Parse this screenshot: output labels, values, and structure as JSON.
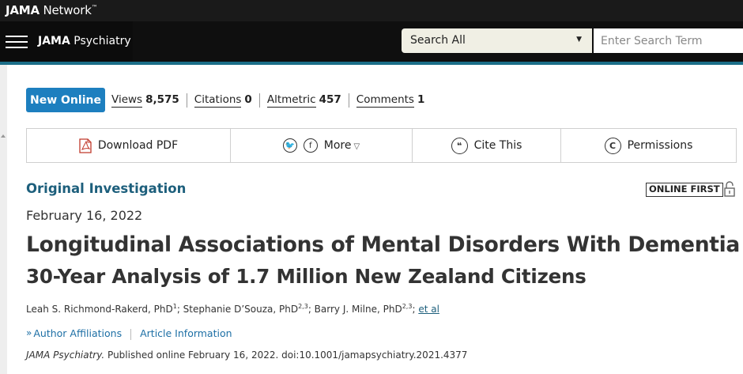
{
  "network": {
    "logo_bold": "JAMA",
    "logo_rest": " Network",
    "logo_mark": "™"
  },
  "journal": {
    "name_bold": "JAMA",
    "name_rest": " Psychiatry"
  },
  "search": {
    "scope_label": "Search All",
    "placeholder": "Enter Search Term"
  },
  "metrics": {
    "new_online_label": "New Online",
    "items": [
      {
        "label": "Views",
        "value": "8,575"
      },
      {
        "label": "Citations",
        "value": "0"
      },
      {
        "label": "Altmetric",
        "value": "457"
      },
      {
        "label": "Comments",
        "value": "1"
      }
    ]
  },
  "toolbar": {
    "pdf_label": "Download PDF",
    "twitter_icon_glyph": "🐦",
    "facebook_icon_glyph": "f",
    "more_label": "More",
    "more_caret": "▽",
    "cite_icon_glyph": "❝",
    "cite_label": "Cite This",
    "permissions_icon_glyph": "C",
    "permissions_label": "Permissions"
  },
  "article": {
    "type": "Original Investigation",
    "badge": "ONLINE FIRST",
    "date": "February 16, 2022",
    "title": "Longitudinal Associations of Mental Disorders With Dementia",
    "subtitle": "30-Year Analysis of 1.7 Million New Zealand Citizens",
    "authors": [
      {
        "name": "Leah S. Richmond-Rakerd, PhD",
        "aff": "1",
        "sep": "; "
      },
      {
        "name": "Stephanie D’Souza, PhD",
        "aff": "2,3",
        "sep": "; "
      },
      {
        "name": "Barry J. Milne, PhD",
        "aff": "2,3",
        "sep": "; "
      }
    ],
    "et_al": "et al",
    "links": {
      "chevron": "»",
      "affiliations": "Author Affiliations",
      "info": "Article Information"
    },
    "citation": {
      "journal": "JAMA Psychiatry.",
      "rest": " Published online February 16, 2022. doi:10.1001/jamapsychiatry.2021.4377"
    }
  }
}
